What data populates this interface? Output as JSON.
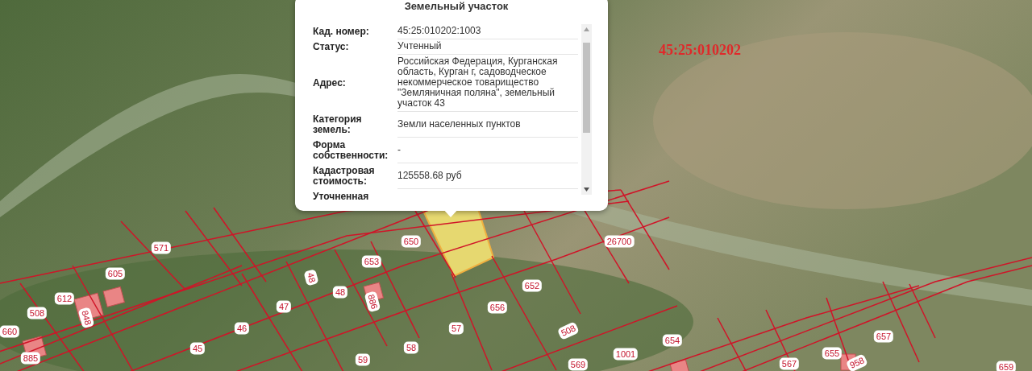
{
  "map": {
    "quarter_label": "45:25:010202",
    "parcel_labels": [
      {
        "text": "571"
      },
      {
        "text": "605"
      },
      {
        "text": "612"
      },
      {
        "text": "508"
      },
      {
        "text": "848"
      },
      {
        "text": "660"
      },
      {
        "text": "885"
      },
      {
        "text": "48"
      },
      {
        "text": "48"
      },
      {
        "text": "47"
      },
      {
        "text": "46"
      },
      {
        "text": "45"
      },
      {
        "text": "650"
      },
      {
        "text": "653"
      },
      {
        "text": "886"
      },
      {
        "text": "652"
      },
      {
        "text": "656"
      },
      {
        "text": "57"
      },
      {
        "text": "58"
      },
      {
        "text": "59"
      },
      {
        "text": "26700"
      },
      {
        "text": "508"
      },
      {
        "text": "1001"
      },
      {
        "text": "654"
      },
      {
        "text": "569"
      },
      {
        "text": "657"
      },
      {
        "text": "655"
      },
      {
        "text": "567"
      },
      {
        "text": "659"
      },
      {
        "text": "958"
      }
    ]
  },
  "popup": {
    "title": "Земельный участок",
    "rows": [
      {
        "label": "Кад. номер:",
        "value": "45:25:010202:1003"
      },
      {
        "label": "Статус:",
        "value": "Учтенный"
      },
      {
        "label": "Адрес:",
        "value": "Российская Федерация, Курганская область, Курган г, садоводческое некоммерческое товарищество \"Земляничная поляна\", земельный участок 43"
      },
      {
        "label": "Категория земель:",
        "value": "Земли населенных пунктов"
      },
      {
        "label": "Форма собственности:",
        "value": "-"
      },
      {
        "label": "Кадастровая стоимость:",
        "value": "125558.68 руб"
      },
      {
        "label": "Уточненная"
      }
    ]
  }
}
